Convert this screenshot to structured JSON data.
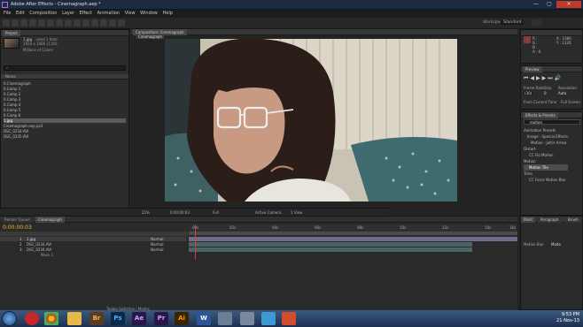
{
  "window": {
    "title": "Adobe After Effects - Cinemagraph.aep *",
    "min": "—",
    "max": "▢",
    "close": "✕"
  },
  "menu": [
    "File",
    "Edit",
    "Composition",
    "Layer",
    "Effect",
    "Animation",
    "View",
    "Window",
    "Help"
  ],
  "toolbar": {
    "workspace": "Standard"
  },
  "project": {
    "tab": "Project",
    "asset_name": "1.jpg",
    "asset_used": "used 1 time",
    "asset_dims": "1920 x 1080 (1.00)",
    "asset_colors": "Millions of Colors",
    "items": [
      "0.Cinemagraph",
      "0.Comp 1",
      "0.Comp 2",
      "0.Comp 3",
      "0.Comp 4",
      "0.Comp 5",
      "0.Comp 6",
      "1.jpg",
      "Cinemagraph.aep.ps3",
      "DSC_0234.AVI",
      "DSC_0235.AVI"
    ],
    "selected_index": 7,
    "bpc": "8 bpc"
  },
  "viewer": {
    "tab": "Composition: Cinemagraph",
    "comp_label": "Cinemagraph",
    "zoom": "25%",
    "timecode": "0:00:00:03",
    "res": "Full",
    "camera": "Active Camera",
    "views": "1 View"
  },
  "info": {
    "R": "R :",
    "G": "G :",
    "B": "B :",
    "A": "A : 0",
    "X": "X : 1380",
    "Y": "Y : 1126"
  },
  "preview": {
    "tab": "Preview",
    "frame_rate_label": "Frame Rate",
    "skip_label": "Skip",
    "res_label": "Resolution",
    "frame_rate": "(30)",
    "skip": "0",
    "res": "Auto",
    "from_current": "From Current Time",
    "full_screen": "Full Screen"
  },
  "effects": {
    "tab": "Effects & Presets",
    "search": "motion",
    "items": [
      "Animation Presets",
      "Image - Special Effects",
      "Motion - Joltin Arrow",
      "Distort",
      "CC Flo Motion",
      "Motion",
      "Motion Tile",
      "Time",
      "CC Force Motion Blur"
    ]
  },
  "timeline": {
    "tabs": [
      "Render Queue",
      "Cinemagraph"
    ],
    "timecode": "0:00:00:03",
    "layers": [
      {
        "num": "1",
        "name": "1.jpg",
        "mode": "Normal"
      },
      {
        "num": "2",
        "name": "DSC_0234.AVI",
        "mode": "Normal"
      },
      {
        "num": "3",
        "name": "DSC_0234.AVI",
        "mode": "Normal"
      }
    ],
    "mask": "Mask 1",
    "ruler": [
      "00s",
      "02s",
      "04s",
      "06s",
      "08s",
      "10s",
      "12s",
      "14s",
      "16s"
    ],
    "toggle": "Toggle Switches / Modes"
  },
  "character": {
    "tabs": [
      "Paint",
      "Paragraph",
      "Brush"
    ],
    "label": "Motion Blur",
    "value": "Mode"
  },
  "taskbar": {
    "apps": [
      "Br",
      "Ps",
      "Ae",
      "Pr",
      "Ai",
      "W"
    ],
    "time": "9:53 PM",
    "date": "21-Nov-13"
  }
}
